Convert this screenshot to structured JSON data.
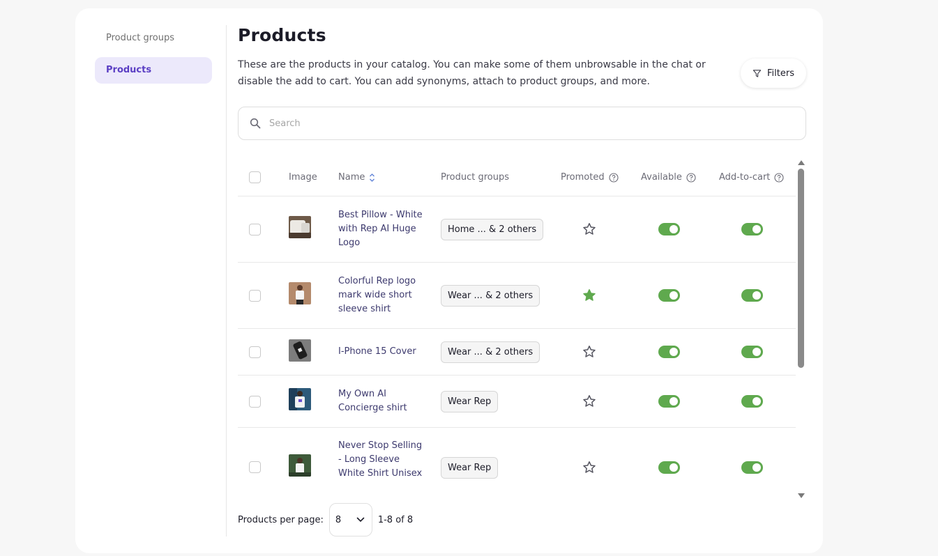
{
  "sidebar": {
    "items": [
      {
        "label": "Product groups",
        "active": false
      },
      {
        "label": "Products",
        "active": true
      }
    ]
  },
  "header": {
    "title": "Products",
    "description": "These are the products in your catalog. You can make some of them unbrowsable in the chat or disable the add to cart. You can add synonyms, attach to product groups, and more.",
    "filters_label": "Filters"
  },
  "search": {
    "placeholder": "Search",
    "value": ""
  },
  "table": {
    "columns": {
      "image": "Image",
      "name": "Name",
      "product_groups": "Product groups",
      "promoted": "Promoted",
      "available": "Available",
      "add_to_cart": "Add-to-cart"
    },
    "rows": [
      {
        "name": "Best Pillow - White with Rep AI Huge Logo",
        "groups": "Home ... & 2 others",
        "promoted": false,
        "available": true,
        "add_to_cart": true
      },
      {
        "name": "Colorful Rep logo mark wide short sleeve shirt",
        "groups": "Wear ...  & 2 others",
        "promoted": true,
        "available": true,
        "add_to_cart": true
      },
      {
        "name": "I-Phone 15 Cover",
        "groups": "Wear ...  & 2 others",
        "promoted": false,
        "available": true,
        "add_to_cart": true
      },
      {
        "name": "My Own AI Concierge shirt",
        "groups": "Wear Rep",
        "promoted": false,
        "available": true,
        "add_to_cart": true
      },
      {
        "name": "Never Stop Selling - Long Sleeve White Shirt Unisex",
        "groups": "Wear Rep",
        "promoted": false,
        "available": true,
        "add_to_cart": true
      }
    ]
  },
  "pagination": {
    "per_page_label": "Products per page:",
    "per_page_value": "8",
    "range": "1-8 of 8"
  },
  "colors": {
    "accent": "#5b3fc4",
    "accent_bg": "#ece9fb",
    "toggle_on": "#5fa94e",
    "star_promoted": "#5fa94e",
    "link_text": "#3d3a6e"
  }
}
